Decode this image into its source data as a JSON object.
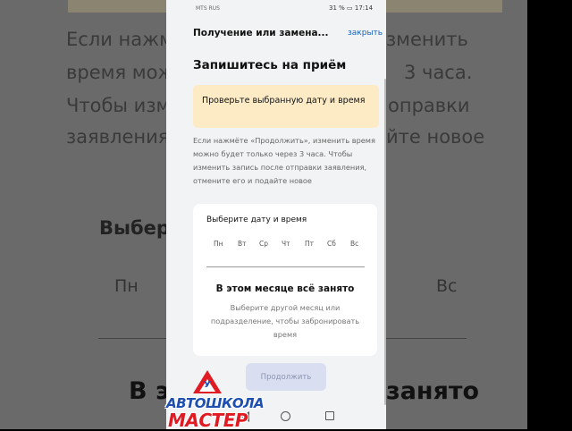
{
  "background": {
    "left_lines": [
      "Если нажм",
      "время мож",
      "Чтобы изм",
      "заявления"
    ],
    "right_lines": [
      "зменить",
      "3 часа.",
      "оправки",
      "йте новое"
    ],
    "left_heading": "Выбер",
    "left_day": "Пн",
    "right_day": "Вс",
    "left_big": "В эт",
    "right_big": "занято"
  },
  "status_bar": {
    "carrier": "MTS RUS",
    "battery": "31 %",
    "time": "17:14"
  },
  "topbar": {
    "title": "Получение или замена...",
    "close_label": "закрыть"
  },
  "page": {
    "heading": "Запишитесь на приём",
    "warning": "Проверьте выбранную дату и время",
    "note": "Если нажмёте «Продолжить», изменить время можно будет только через 3 часа. Чтобы изменить запись после отправки заявления, отмените его и подайте новое"
  },
  "calendar": {
    "heading": "Выберите дату и время",
    "days": [
      "Пн",
      "Вт",
      "Ср",
      "Чт",
      "Пт",
      "Сб",
      "Вс"
    ],
    "empty_title": "В этом месяце всё занято",
    "empty_subtitle": "Выберите другой месяц или подразделение, чтобы забронировать время"
  },
  "continue_label": "Продолжить",
  "logo": {
    "sign_letter": "У",
    "line1": "АВТОШКОЛА",
    "line2": "МАСТЕР"
  },
  "colors": {
    "accent": "#1a62b8",
    "warning_bg": "#fdebc6",
    "button_disabled_bg": "#d9def0"
  }
}
